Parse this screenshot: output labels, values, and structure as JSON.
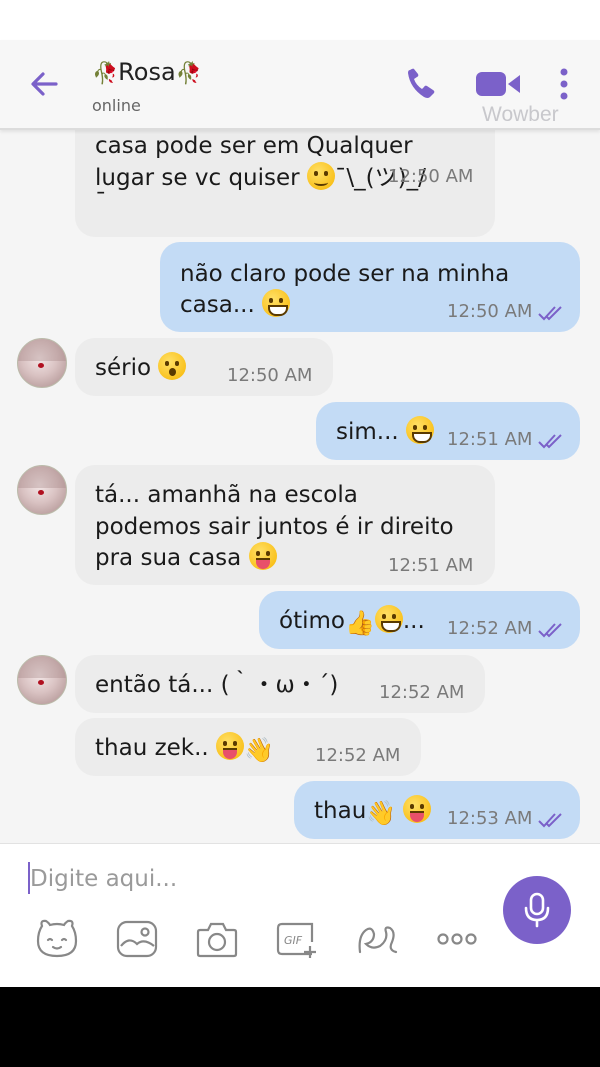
{
  "header": {
    "contact_name": "Rosa",
    "name_decoration": "🥀",
    "status": "online",
    "watermark": "Wowber"
  },
  "messages": [
    {
      "dir": "in",
      "lines": [
        "casa pode ser em Qualquer",
        "lugar se vc quiser 🥺¯\\_(ツ)_/",
        "¯"
      ],
      "time": "12:50 AM"
    },
    {
      "dir": "out",
      "lines": [
        "não claro pode ser na minha",
        "casa... 😁"
      ],
      "time": "12:50 AM",
      "read": true
    },
    {
      "dir": "in",
      "lines": [
        "sério 😮"
      ],
      "time": "12:50 AM"
    },
    {
      "dir": "out",
      "lines": [
        "sim... 😁"
      ],
      "time": "12:51 AM",
      "read": true
    },
    {
      "dir": "in",
      "lines": [
        "tá... amanhã na escola",
        "podemos sair juntos é ir direito",
        "pra sua casa 😛"
      ],
      "time": "12:51 AM"
    },
    {
      "dir": "out",
      "lines": [
        "ótimo👍😁..."
      ],
      "time": "12:52 AM",
      "read": true
    },
    {
      "dir": "in",
      "lines": [
        "então tá... (｀・ω・´)"
      ],
      "time": "12:52 AM"
    },
    {
      "dir": "in",
      "lines": [
        "thau zek.. 😛👋"
      ],
      "time": "12:52 AM"
    },
    {
      "dir": "out",
      "lines": [
        "thau👋 😋"
      ],
      "time": "12:53 AM",
      "read": true
    }
  ],
  "composer": {
    "placeholder": "Digite aqui..."
  },
  "toolbar": {
    "icons": [
      "sticker-icon",
      "gallery-icon",
      "camera-icon",
      "gif-icon",
      "doodle-icon",
      "more-options-icon",
      "microphone-icon"
    ]
  },
  "colors": {
    "accent": "#7b61c9",
    "incoming_bubble": "#ececec",
    "outgoing_bubble": "#c3dbf5",
    "read_receipt": "#7b61c9"
  }
}
